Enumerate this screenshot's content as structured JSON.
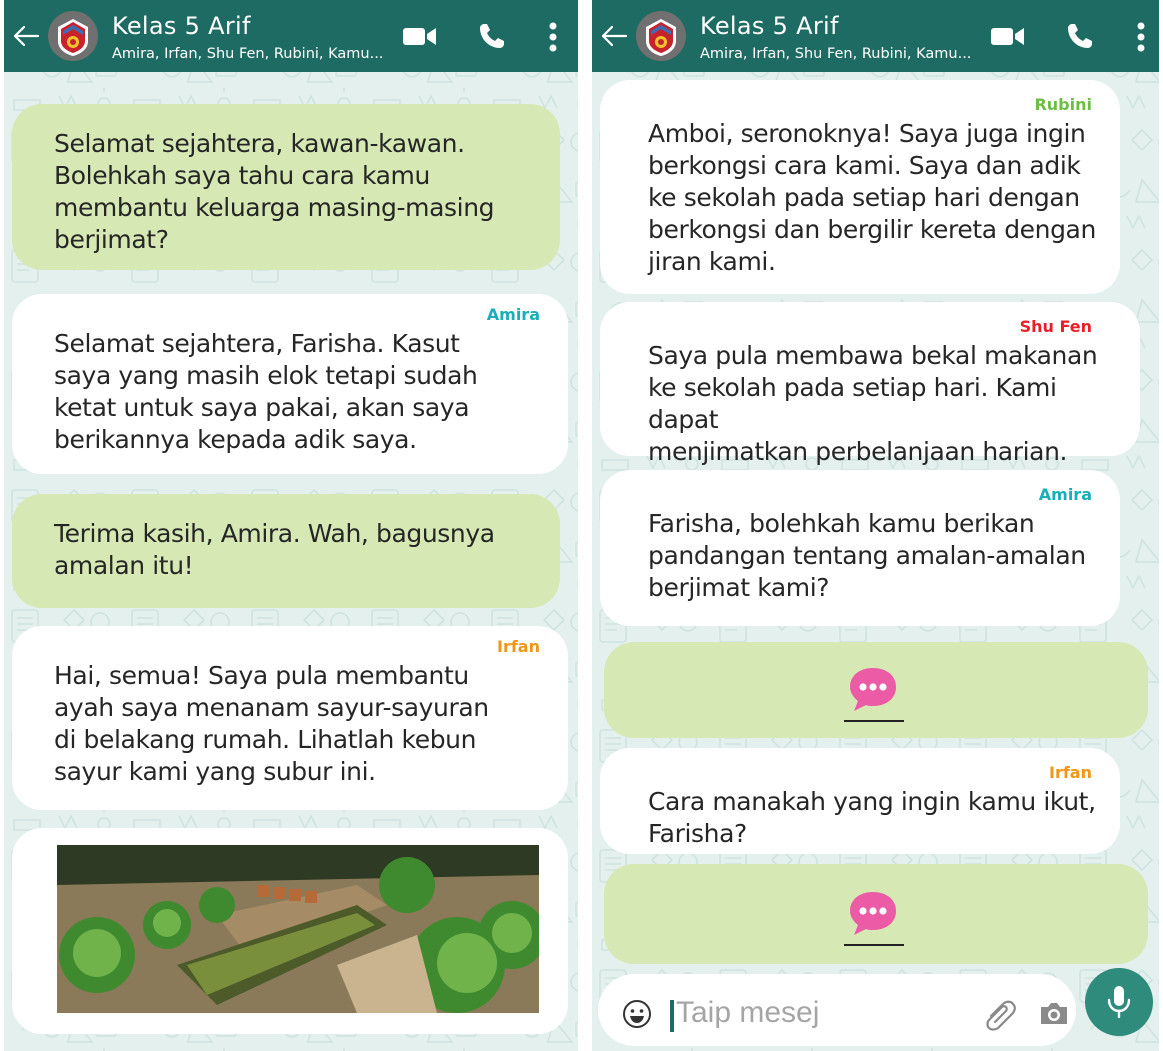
{
  "chat": {
    "title": "Kelas 5 Arif",
    "members": "Amira, Irfan, Shu Fen, Rubini, Kamu..."
  },
  "left_messages": [
    {
      "type": "outgoing",
      "text": "Selamat sejahtera, kawan-kawan.\nBolehkah saya tahu cara kamu\nmembantu keluarga masing-masing\nberjimat?"
    },
    {
      "type": "incoming",
      "sender": "Amira",
      "text": "Selamat sejahtera, Farisha. Kasut\nsaya yang masih elok tetapi sudah\nketat untuk saya pakai, akan saya\nberikannya kepada adik saya."
    },
    {
      "type": "outgoing",
      "text": "Terima kasih, Amira. Wah, bagusnya\namalan itu!"
    },
    {
      "type": "incoming",
      "sender": "Irfan",
      "text": "Hai, semua! Saya pula membantu\nayah saya menanam sayur-sayuran\ndi belakang rumah. Lihatlah kebun\nsayur kami yang subur ini."
    },
    {
      "type": "image",
      "description": "vegetable-garden-photo"
    }
  ],
  "right_messages": [
    {
      "type": "incoming",
      "sender": "Rubini",
      "text": "Amboi, seronoknya! Saya juga ingin\nberkongsi cara kami. Saya dan adik\nke sekolah pada setiap hari dengan\nberkongsi dan bergilir kereta dengan\njiran kami."
    },
    {
      "type": "incoming",
      "sender": "Shu Fen",
      "text": "Saya pula membawa bekal makanan\nke sekolah pada setiap hari. Kami dapat\nmenjimatkan perbelanjaan harian."
    },
    {
      "type": "incoming",
      "sender": "Amira",
      "text": "Farisha, bolehkah kamu berikan\npandangan tentang amalan-amalan\nberjimat kami?"
    },
    {
      "type": "outgoing",
      "icon": "typing-bubble-icon"
    },
    {
      "type": "incoming",
      "sender": "Irfan",
      "text": "Cara manakah yang ingin kamu ikut,\nFarisha?"
    },
    {
      "type": "outgoing",
      "icon": "typing-bubble-icon"
    }
  ],
  "input": {
    "placeholder": "Taip mesej"
  },
  "colors": {
    "header": "#1e6b63",
    "outgoing_bubble": "#d6e8b4",
    "incoming_bubble": "#ffffff",
    "chat_background": "#e3f0ee",
    "amira": "#1aafb8",
    "irfan": "#f0961a",
    "rubini": "#6cbe45",
    "shufen": "#e8202a",
    "typing_icon": "#ec5ba5",
    "mic_button": "#2f8b7c"
  }
}
